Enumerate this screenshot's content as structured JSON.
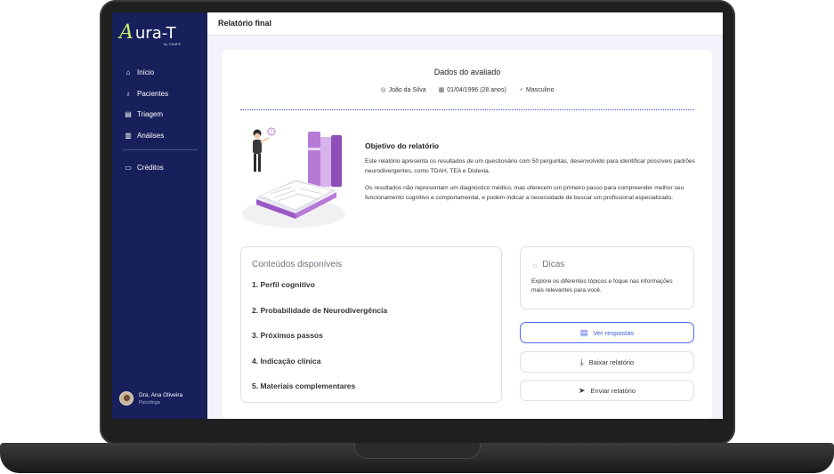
{
  "app": {
    "logo_mark": "A",
    "logo_text": "ura-T",
    "logo_sub": "by ⊙KAPE"
  },
  "sidebar": {
    "items": [
      {
        "label": "Início",
        "icon": "home-icon",
        "glyph": "⌂"
      },
      {
        "label": "Pacientes",
        "icon": "user-icon",
        "glyph": "♁"
      },
      {
        "label": "Triagem",
        "icon": "clipboard-icon",
        "glyph": "▤"
      },
      {
        "label": "Análises",
        "icon": "chart-icon",
        "glyph": "▥"
      }
    ],
    "secondary_items": [
      {
        "label": "Créditos",
        "icon": "wallet-icon",
        "glyph": "▭"
      }
    ],
    "user": {
      "name": "Dra. Ana Oliveira",
      "role": "Psicóloga"
    }
  },
  "header": {
    "title": "Relatório final"
  },
  "evaluated": {
    "title": "Dados do avaliado",
    "name": "João da Silva",
    "birth": "01/04/1996 (28 anos)",
    "gender": "Masculino"
  },
  "objective": {
    "title": "Objetivo do relatório",
    "paragraph1": "Este relatório apresenta os resultados de um questionário com 50 perguntas, desenvolvido para identificar possíveis padrões neurodivergentes, como TDAH, TEA e Dislexia.",
    "paragraph2": "Os resultados não representam um diagnóstico médico, mas oferecem um primeiro passo para compreender melhor seu funcionamento cognitivo e comportamental, e podem indicar a necessidade de buscar um profissional especializado."
  },
  "contents": {
    "title": "Conteúdos disponíveis",
    "items": [
      "1. Perfil cognitivo",
      "2. Probabilidade de Neurodivergência",
      "3. Próximos passos",
      "4. Indicação clínica",
      "5. Materiais complementares"
    ]
  },
  "tips": {
    "title": "Dicas",
    "text": "Explore os diferentes tópicos e foque nas informações mais relevantes para você."
  },
  "actions": {
    "view_answers": "Ver respostas",
    "download": "Baixar relatório",
    "send": "Enviar relatório"
  },
  "colors": {
    "sidebar": "#17205a",
    "accent": "#3d4bd1",
    "logo_accent": "#c9f06b"
  }
}
